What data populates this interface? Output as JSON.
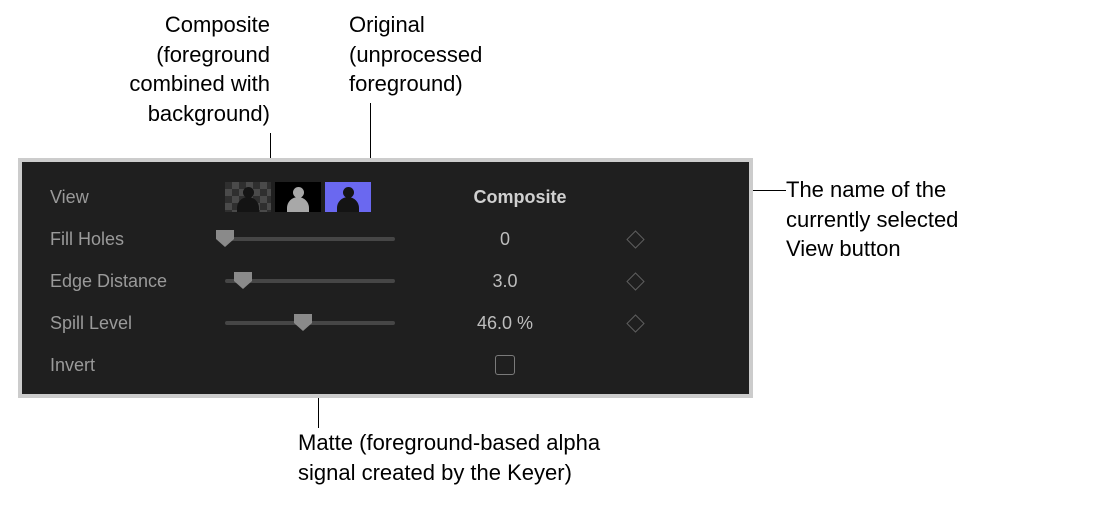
{
  "annotations": {
    "composite": "Composite\n(foreground\ncombined with\nbackground)",
    "original": "Original\n(unprocessed\nforeground)",
    "view_name": "The name of the\ncurrently selected\nView button",
    "matte": "Matte (foreground-based alpha\nsignal created by the Keyer)"
  },
  "panel": {
    "view": {
      "label": "View",
      "value": "Composite"
    },
    "fill_holes": {
      "label": "Fill Holes",
      "value": "0",
      "pos": 0
    },
    "edge_distance": {
      "label": "Edge Distance",
      "value": "3.0",
      "pos": 18
    },
    "spill_level": {
      "label": "Spill Level",
      "value": "46.0 %",
      "pos": 78
    },
    "invert": {
      "label": "Invert",
      "checked": false
    }
  }
}
